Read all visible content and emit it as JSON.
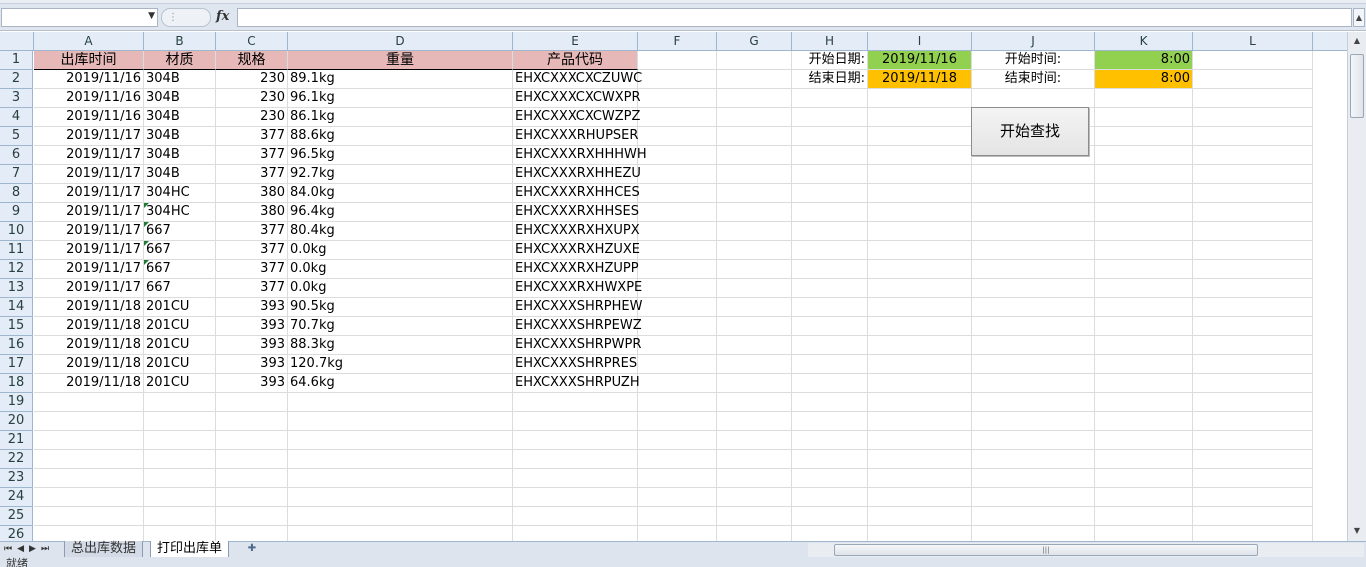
{
  "formula_bar": {
    "fx_label": "fx",
    "name_box": "",
    "formula": ""
  },
  "columns": [
    "A",
    "B",
    "C",
    "D",
    "E",
    "F",
    "G",
    "H",
    "I",
    "J",
    "K",
    "L"
  ],
  "row_numbers": [
    "1",
    "2",
    "3",
    "4",
    "5",
    "6",
    "7",
    "8",
    "9",
    "10",
    "11",
    "12",
    "13",
    "14",
    "15",
    "16",
    "17",
    "18",
    "19",
    "20",
    "21",
    "22",
    "23",
    "24",
    "25",
    "26"
  ],
  "headers": {
    "date": "出库时间",
    "material": "材质",
    "spec": "规格",
    "weight": "重量",
    "code": "产品代码"
  },
  "rows": [
    [
      "2019/11/16",
      "304B",
      "230",
      "89.1kg",
      "EHXCXXXCXCZUWC"
    ],
    [
      "2019/11/16",
      "304B",
      "230",
      "96.1kg",
      "EHXCXXXCXCWXPR"
    ],
    [
      "2019/11/16",
      "304B",
      "230",
      "86.1kg",
      "EHXCXXXCXCWZPZ"
    ],
    [
      "2019/11/17",
      "304B",
      "377",
      "88.6kg",
      "EHXCXXXRHUPSER"
    ],
    [
      "2019/11/17",
      "304B",
      "377",
      "96.5kg",
      "EHXCXXXRXHHHWH"
    ],
    [
      "2019/11/17",
      "304B",
      "377",
      "92.7kg",
      "EHXCXXXRXHHEZU"
    ],
    [
      "2019/11/17",
      "304HC",
      "380",
      "84.0kg",
      "EHXCXXXRXHHCES"
    ],
    [
      "2019/11/17",
      "304HC",
      "380",
      "96.4kg",
      "EHXCXXXRXHHSES"
    ],
    [
      "2019/11/17",
      "667",
      "377",
      "80.4kg",
      "EHXCXXXRXHXUPX"
    ],
    [
      "2019/11/17",
      "667",
      "377",
      "0.0kg",
      "EHXCXXXRXHZUXE"
    ],
    [
      "2019/11/17",
      "667",
      "377",
      "0.0kg",
      "EHXCXXXRXHZUPP"
    ],
    [
      "2019/11/17",
      "667",
      "377",
      "0.0kg",
      "EHXCXXXRXHWXPE"
    ],
    [
      "2019/11/18",
      "201CU",
      "393",
      "90.5kg",
      "EHXCXXXSHRPHEW"
    ],
    [
      "2019/11/18",
      "201CU",
      "393",
      "70.7kg",
      "EHXCXXXSHRPEWZ"
    ],
    [
      "2019/11/18",
      "201CU",
      "393",
      "88.3kg",
      "EHXCXXXSHRPWPR"
    ],
    [
      "2019/11/18",
      "201CU",
      "393",
      "120.7kg",
      "EHXCXXXSHRPRES"
    ],
    [
      "2019/11/18",
      "201CU",
      "393",
      "64.6kg",
      "EHXCXXXSHRPUZH"
    ]
  ],
  "text_number_rows": [
    9,
    10,
    11,
    12
  ],
  "criteria": {
    "start_date_label": "开始日期:",
    "start_date": "2019/11/16",
    "end_date_label": "结束日期:",
    "end_date": "2019/11/18",
    "start_time_label": "开始时间:",
    "start_time": "8:00",
    "end_time_label": "结束时间:",
    "end_time": "8:00"
  },
  "search_button": "开始查找",
  "sheet_tabs": [
    {
      "label": "总出库数据",
      "active": false
    },
    {
      "label": "打印出库单",
      "active": true
    }
  ],
  "status_bar": {
    "ready": "就绪"
  },
  "colors": {
    "header_fill": "#e6b8b7",
    "start_fill": "#92d050",
    "end_fill": "#ffc000"
  }
}
